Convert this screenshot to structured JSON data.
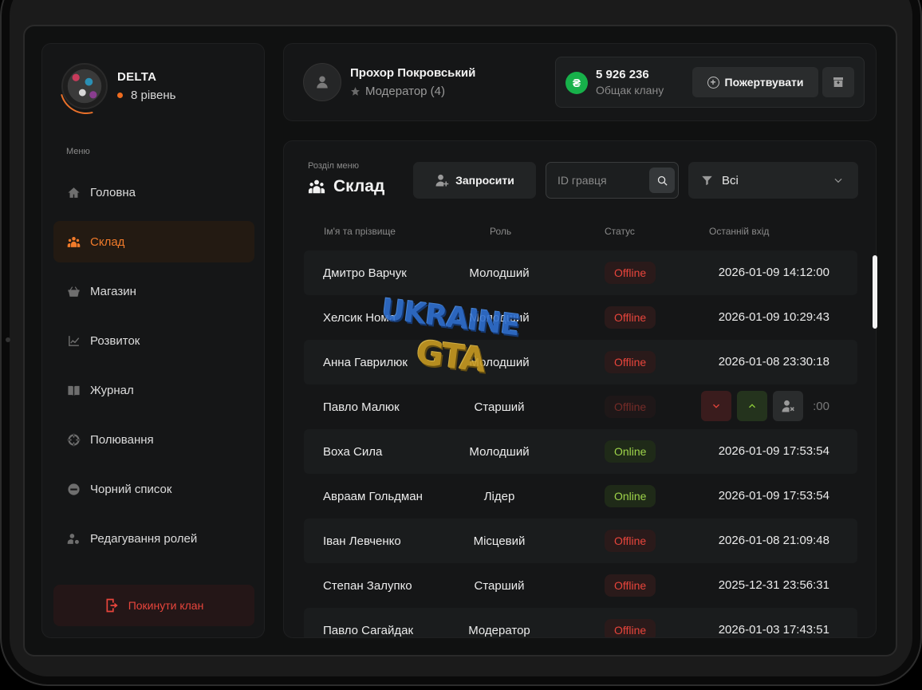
{
  "clan": {
    "name": "DELTA",
    "level": "8 рівень"
  },
  "menu_label": "Меню",
  "menu": [
    {
      "label": "Головна",
      "icon": "home-icon"
    },
    {
      "label": "Склад",
      "icon": "users-icon",
      "active": true
    },
    {
      "label": "Магазин",
      "icon": "basket-icon"
    },
    {
      "label": "Розвиток",
      "icon": "chart-icon"
    },
    {
      "label": "Журнал",
      "icon": "book-icon"
    },
    {
      "label": "Полювання",
      "icon": "crosshair-icon"
    },
    {
      "label": "Чорний список",
      "icon": "block-icon"
    },
    {
      "label": "Редагування ролей",
      "icon": "user-gear-icon"
    }
  ],
  "leave_label": "Покинути клан",
  "user": {
    "name": "Прохор Покровський",
    "role": "Модератор (4)"
  },
  "bank": {
    "currency_symbol": "₴",
    "amount": "5 926 236",
    "label": "Общак клану",
    "donate_label": "Пожертвувати"
  },
  "section": {
    "subtitle": "Розділ меню",
    "title": "Склад"
  },
  "toolbar": {
    "invite_label": "Запросити",
    "search_placeholder": "ID гравця",
    "filter_value": "Всі"
  },
  "table": {
    "headers": {
      "name": "Ім'я та прізвище",
      "role": "Роль",
      "status": "Статус",
      "last_login": "Останній вхід"
    },
    "rows": [
      {
        "name": "Дмитро Варчук",
        "role": "Молодший",
        "status": "Offline",
        "last_login": "2026-01-09 14:12:00"
      },
      {
        "name": "Хелсик Нома",
        "role": "Молодший",
        "status": "Offline",
        "last_login": "2026-01-09 10:29:43"
      },
      {
        "name": "Анна Гаврилюк",
        "role": "Молодший",
        "status": "Offline",
        "last_login": "2026-01-08 23:30:18"
      },
      {
        "name": "Павло Малюк",
        "role": "Старший",
        "status": "Offline",
        "last_login": ":00"
      },
      {
        "name": "Воха Сила",
        "role": "Молодший",
        "status": "Online",
        "last_login": "2026-01-09 17:53:54"
      },
      {
        "name": "Авраам Гольдман",
        "role": "Лідер",
        "status": "Online",
        "last_login": "2026-01-09 17:53:54"
      },
      {
        "name": "Іван Левченко",
        "role": "Місцевий",
        "status": "Offline",
        "last_login": "2026-01-08 21:09:48"
      },
      {
        "name": "Степан Залупко",
        "role": "Старший",
        "status": "Offline",
        "last_login": "2025-12-31 23:56:31"
      },
      {
        "name": "Павло Сагайдак",
        "role": "Модератор",
        "status": "Offline",
        "last_login": "2026-01-03 17:43:51"
      }
    ]
  },
  "watermark": {
    "line1": "UKRAINE",
    "line2": "GTA"
  },
  "colors": {
    "accent": "#f07a2a",
    "offline": "#e8453c",
    "online": "#9ed34a",
    "bank_green": "#17b14a"
  }
}
